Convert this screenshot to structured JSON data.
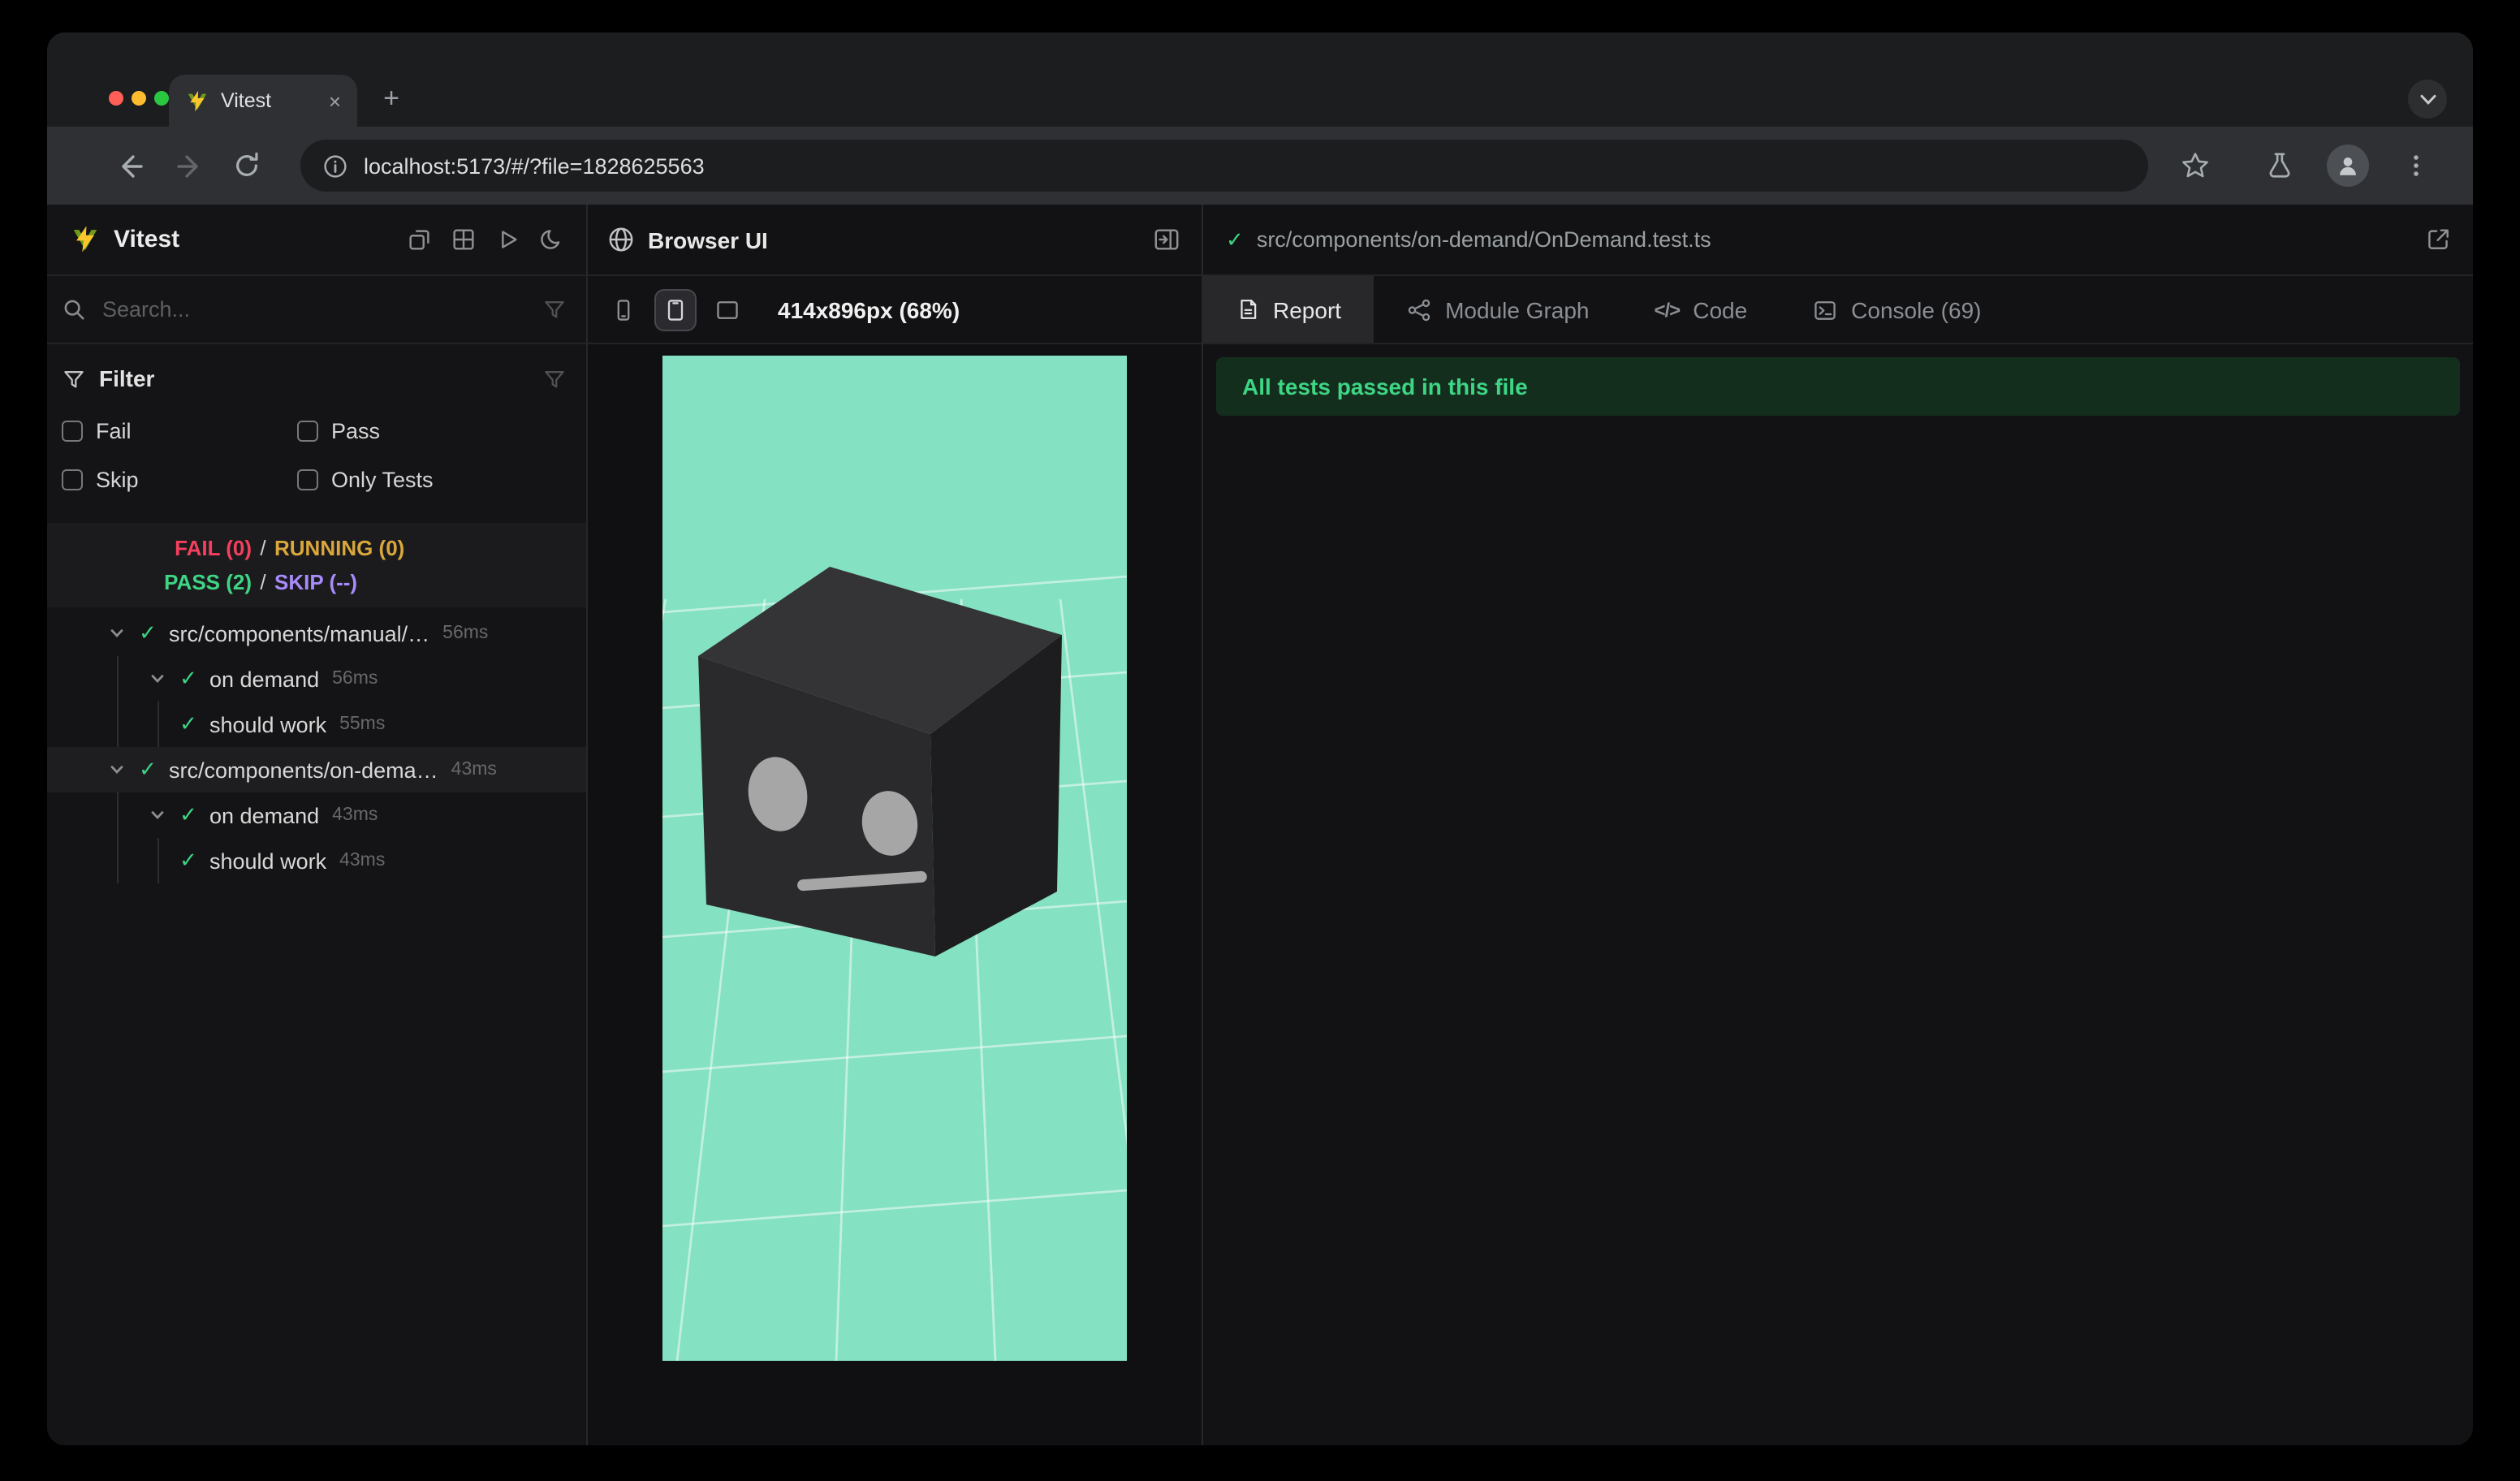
{
  "browser": {
    "tab_title": "Vitest",
    "close_tab": "×",
    "new_tab": "+",
    "url": "localhost:5173/#/?file=1828625563"
  },
  "sidebar": {
    "app_title": "Vitest",
    "search_placeholder": "Search...",
    "filter": {
      "title": "Filter",
      "options": [
        "Fail",
        "Pass",
        "Skip",
        "Only Tests"
      ]
    },
    "summary": {
      "fail": "FAIL (0)",
      "sep1": "/",
      "running": "RUNNING (0)",
      "pass": "PASS (2)",
      "sep2": "/",
      "skip": "SKIP (--)"
    },
    "tree": [
      {
        "label": "src/components/manual/…",
        "duration": "56ms"
      },
      {
        "label": "on demand",
        "duration": "56ms"
      },
      {
        "label": "should work",
        "duration": "55ms"
      },
      {
        "label": "src/components/on-dema…",
        "duration": "43ms"
      },
      {
        "label": "on demand",
        "duration": "43ms"
      },
      {
        "label": "should work",
        "duration": "43ms"
      }
    ]
  },
  "browser_panel": {
    "title": "Browser UI",
    "viewport_label": "414x896px (68%)"
  },
  "report_panel": {
    "file_path": "src/components/on-demand/OnDemand.test.ts",
    "tabs": [
      "Report",
      "Module Graph",
      "Code",
      "Console (69)"
    ],
    "code_icon": "</>",
    "banner": "All tests passed in this file"
  },
  "colors": {
    "viewport_bg": "#84e1c1",
    "pass_green": "#3ed584",
    "fail_red": "#f43f5e",
    "running_yellow": "#d9a73c",
    "skip_purple": "#a78bfa",
    "banner_bg": "#142e1e",
    "banner_text": "#3ed584"
  }
}
